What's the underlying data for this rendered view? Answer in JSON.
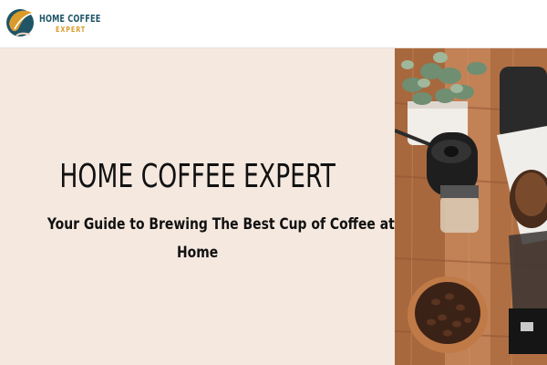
{
  "header": {
    "logo": {
      "name": "HOME COFFEE",
      "tagline": "EXPERT"
    }
  },
  "hero": {
    "title": "HOME COFFEE EXPERT",
    "subtitle_line1": "Your Guide to Brewing The Best Cup of Coffee at",
    "subtitle_line2": "Home",
    "panel_color": "#f5e8df"
  },
  "colors": {
    "brand_teal": "#1f5566",
    "brand_gold": "#d99b2b",
    "text_dark": "#111111"
  }
}
